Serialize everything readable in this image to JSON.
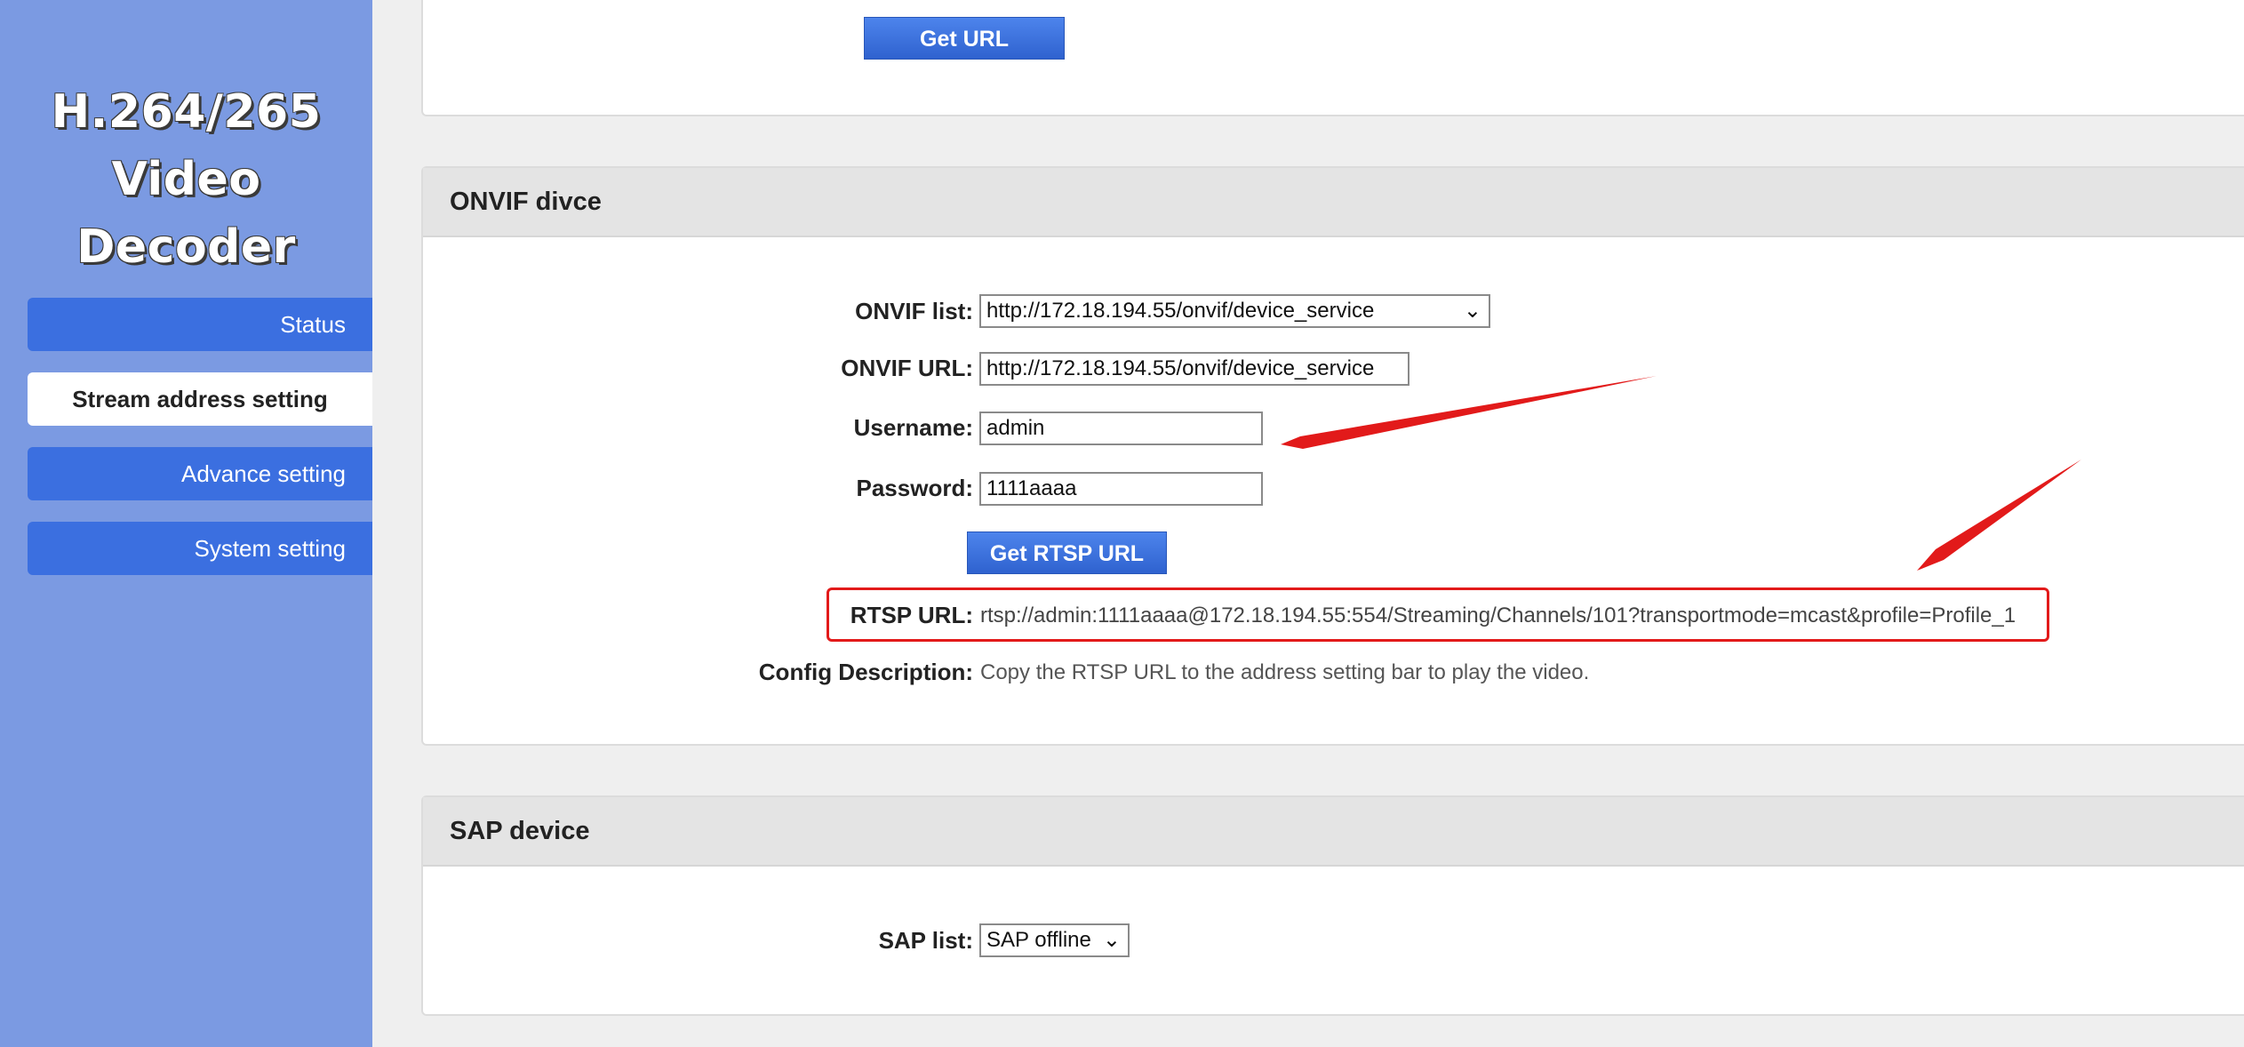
{
  "sidebar": {
    "logo_line1": "H.264/265",
    "logo_line2": "Video Decoder",
    "items": [
      {
        "label": "Status"
      },
      {
        "label": "Stream address setting"
      },
      {
        "label": "Advance setting"
      },
      {
        "label": "System setting"
      }
    ]
  },
  "top_panel": {
    "get_url_label": "Get URL"
  },
  "onvif_panel": {
    "title": "ONVIF divce",
    "list_label": "ONVIF list:",
    "list_value": "http://172.18.194.55/onvif/device_service",
    "url_label": "ONVIF URL:",
    "url_value": "http://172.18.194.55/onvif/device_service",
    "username_label": "Username:",
    "username_value": "admin",
    "password_label": "Password:",
    "password_value": "1111aaaa",
    "get_rtsp_label": "Get RTSP URL",
    "rtsp_label": "RTSP URL:",
    "rtsp_value": "rtsp://admin:1111aaaa@172.18.194.55:554/Streaming/Channels/101?transportmode=mcast&profile=Profile_1",
    "config_label": "Config Description:",
    "config_value": "Copy the RTSP URL to the address setting bar to play the video."
  },
  "sap_panel": {
    "title": "SAP device",
    "list_label": "SAP list:",
    "list_value": "SAP offline"
  },
  "colors": {
    "sidebar_bg": "#7b9ae2",
    "nav_button": "#3b6fe0",
    "accent_arrow": "#e21a1a"
  },
  "icons": {
    "dropdown": "chevron-down-icon",
    "annotation": "red-arrow-icon"
  }
}
